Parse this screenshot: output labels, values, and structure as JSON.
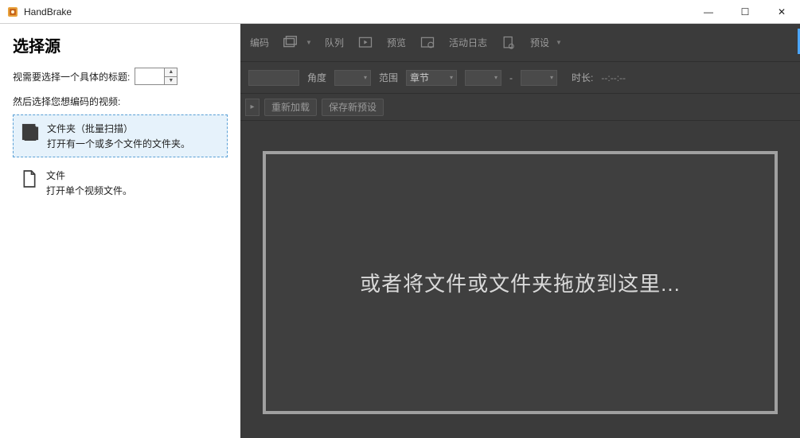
{
  "app": {
    "title": "HandBrake"
  },
  "window_controls": {
    "min": "—",
    "max": "☐",
    "close": "✕"
  },
  "sidebar": {
    "heading": "选择源",
    "title_prompt": "视需要选择一个具体的标题:",
    "title_value": "",
    "prompt2": "然后选择您想编码的视频:",
    "options": [
      {
        "title": "文件夹（批量扫描）",
        "desc": "打开有一个或多个文件的文件夹。"
      },
      {
        "title": "文件",
        "desc": "打开单个视频文件。"
      }
    ]
  },
  "toolbar": {
    "encode": "编码",
    "queue": "队列",
    "preview": "预览",
    "activity": "活动日志",
    "presets": "预设"
  },
  "srcrow": {
    "angle_label": "角度",
    "range_label": "范围",
    "range_mode": "章节",
    "dash": "-",
    "duration_label": "时长:",
    "duration_value": "--:--:--"
  },
  "presetrow": {
    "reload": "重新加载",
    "save_new": "保存新预设"
  },
  "dropzone": {
    "message": "或者将文件或文件夹拖放到这里..."
  }
}
